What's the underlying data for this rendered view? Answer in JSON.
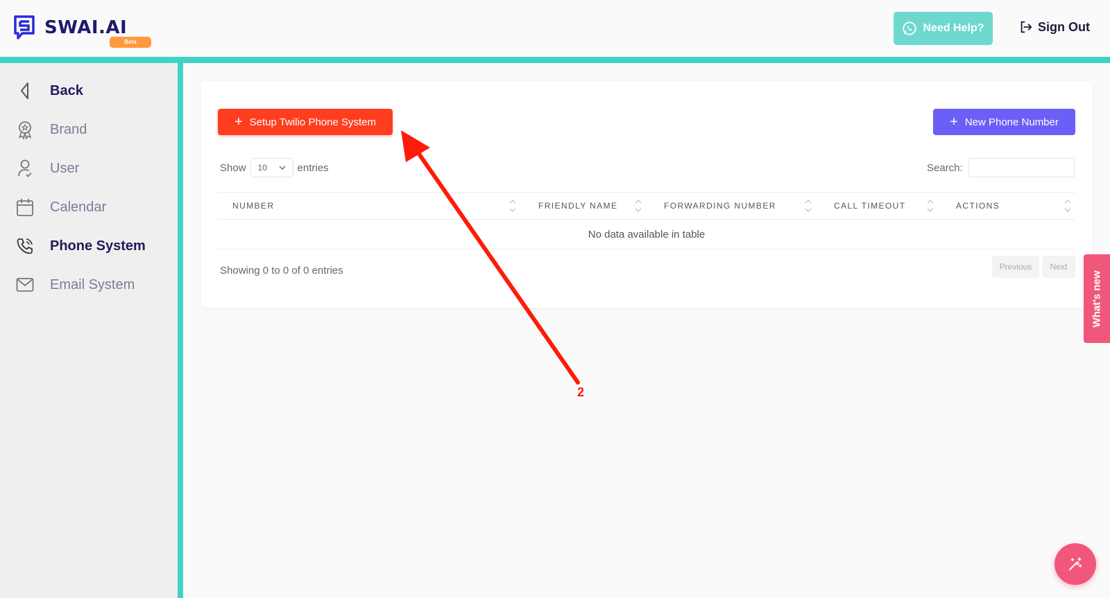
{
  "brand": {
    "name": "SWAI.AI",
    "badge": "Beta"
  },
  "header": {
    "help_label": "Need Help?",
    "signout_label": "Sign Out"
  },
  "sidebar": {
    "items": [
      {
        "label": "Back",
        "icon": "chevron-left-icon",
        "active": true
      },
      {
        "label": "Brand",
        "icon": "award-icon",
        "active": false
      },
      {
        "label": "User",
        "icon": "user-icon",
        "active": false
      },
      {
        "label": "Calendar",
        "icon": "calendar-icon",
        "active": false
      },
      {
        "label": "Phone System",
        "icon": "phone-icon",
        "active": true
      },
      {
        "label": "Email System",
        "icon": "mail-icon",
        "active": false
      }
    ]
  },
  "toolbar": {
    "setup_label": "Setup Twilio Phone System",
    "new_label": "New Phone Number"
  },
  "table": {
    "show_label": "Show",
    "length_value": "10",
    "entries_label": "entries",
    "search_label": "Search:",
    "search_value": "",
    "columns": [
      "NUMBER",
      "FRIENDLY NAME",
      "FORWARDING NUMBER",
      "CALL TIMEOUT",
      "ACTIONS"
    ],
    "empty_message": "No data available in table",
    "info": "Showing 0 to 0 of 0 entries",
    "prev_label": "Previous",
    "next_label": "Next"
  },
  "annotation": {
    "label": "2"
  },
  "whats_new": "What's new",
  "colors": {
    "accent_teal": "#3fd3c5",
    "setup_red": "#ff3d1f",
    "primary_purple": "#6b5ff7",
    "pink": "#f0577a",
    "beta_orange": "#ff9a3c"
  }
}
